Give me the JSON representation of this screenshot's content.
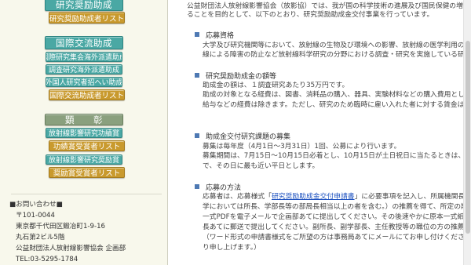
{
  "sidebar": {
    "research_grant_header": "研究奨励助成",
    "research_grant_list": "研究奨励助成者リスト",
    "intl_header": "国際交流助成",
    "intl_items": [
      "国際研究集会海外派遣助成",
      "調査研究海外派遣助成",
      "外国人研究者招へい助成",
      "国際交流助成者リスト"
    ],
    "award_header": "顕　　彰",
    "award_items": [
      "放射線影響研究功績賞",
      "功績賞受賞者リスト",
      "放射線影響研究奨励賞",
      "奨励賞受賞者リスト"
    ],
    "contact": {
      "title": "■お問い合わせ■",
      "lines": [
        "〒101-0044",
        "東京都千代田区鍛冶町1-9-16",
        "丸石第2ビル5階",
        "公益財団法人放射線影響協会 企画部",
        "TEL:03-5295-1784"
      ]
    }
  },
  "main": {
    "intro": [
      "公益財団法人放射線影響協会（放影協）では、我が国の科学技術の進展及び国民保健の増",
      "ることを目的として、以下のとおり、研究奨励助成金交付事業を行っています。"
    ],
    "sections": [
      {
        "heading": "応募資格",
        "lines": [
          "大学及び研究機関等において、放射線の生物及び環境への影響、放射線の医学利用の基礎",
          "線による障害の防止など放射線科学研究の分野における調査・研究を実施している研究者と"
        ]
      },
      {
        "heading": "研究奨励助成金の額等",
        "lines": [
          "助成金の額は、１調査研究あたり35万円です。",
          "助成の対象となる経費は、図書、消耗品の購入、器具、実験材料などの購入費用とし、外",
          "給与などの経費は除きます。ただし、研究のため臨時に雇い入れた者に対する賃金は助成の"
        ]
      },
      {
        "heading": "助成金交付研究課題の募集",
        "lines": [
          "募集は毎年度（4月1日～3月31日）1回、公募により行います。",
          "募集期間は、7月15日～10月15日必着とし、10月15日が土日祝日に当たるときは、その",
          "で、その日に最も近い平日とします。"
        ]
      },
      {
        "heading": "応募の方法",
        "line1_prefix": "応募者は、応募様式「",
        "link_text": "研究奨励助成金交付申請書",
        "line1_suffix": "」に必要事項を記入し、所属機関長（研",
        "lines": [
          "学においては所長、学部長等の部局長相当以上の者を含む。）の推薦を得て、所定の期日ま",
          "一式PDFを電子メールで企画部あてに提出してください。その後速やかに原本一式紙文書を",
          "長あてに郵送で提出してください。副所長、副学部長、主任教授等の職位の方の推薦は受付",
          "（ワード形式の申請書様式をご所望の方は事務局あてにメールにてお申し付けください。折",
          "り申し上げます。）"
        ]
      }
    ]
  },
  "colors": {
    "teal": "#4aa8a4",
    "gold": "#c99a2e",
    "sage": "#8aa07e",
    "heading_marker": "#4e79b3",
    "link": "#1a4fbf"
  }
}
